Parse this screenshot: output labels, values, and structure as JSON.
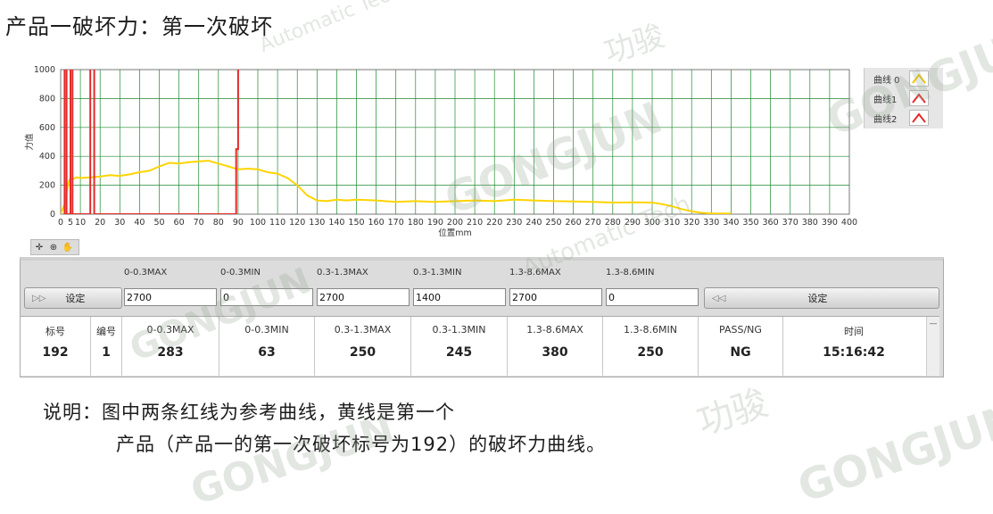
{
  "title": "产品一破坏力：第一次破坏",
  "chart_data": {
    "type": "line",
    "xlabel": "位置mm",
    "ylabel": "力值",
    "xlim": [
      0,
      400
    ],
    "ylim": [
      0,
      1000
    ],
    "x_ticks": [
      0,
      5,
      10,
      20,
      30,
      40,
      50,
      60,
      70,
      80,
      90,
      100,
      110,
      120,
      130,
      140,
      150,
      160,
      170,
      180,
      190,
      200,
      210,
      220,
      230,
      240,
      250,
      260,
      270,
      280,
      290,
      300,
      310,
      320,
      330,
      340,
      350,
      360,
      370,
      380,
      390,
      400
    ],
    "y_ticks": [
      0,
      200,
      400,
      600,
      800,
      1000
    ],
    "grid": true,
    "legend_position": "top-right",
    "series": [
      {
        "name": "曲线 0",
        "color": "#ffd400",
        "x": [
          0,
          2,
          4,
          5,
          6,
          8,
          10,
          15,
          20,
          25,
          30,
          35,
          40,
          45,
          50,
          55,
          60,
          65,
          70,
          75,
          80,
          85,
          90,
          95,
          100,
          105,
          110,
          115,
          120,
          125,
          130,
          135,
          140,
          145,
          150,
          160,
          170,
          180,
          190,
          200,
          210,
          220,
          230,
          240,
          250,
          260,
          270,
          280,
          290,
          300,
          305,
          310,
          315,
          320,
          325,
          330,
          335,
          340
        ],
        "y": [
          0,
          70,
          220,
          250,
          240,
          255,
          250,
          255,
          260,
          270,
          265,
          275,
          290,
          300,
          330,
          355,
          350,
          360,
          365,
          370,
          350,
          330,
          310,
          315,
          310,
          290,
          280,
          250,
          200,
          130,
          95,
          90,
          100,
          95,
          100,
          95,
          85,
          90,
          85,
          90,
          95,
          90,
          100,
          95,
          90,
          88,
          85,
          80,
          82,
          80,
          70,
          55,
          35,
          20,
          10,
          5,
          5,
          5
        ]
      },
      {
        "name": "曲线1",
        "color": "#e32b2b",
        "x": [
          2,
          2,
          3,
          3,
          15,
          15,
          17,
          17,
          89,
          89,
          90,
          90
        ],
        "y": [
          0,
          1050,
          1050,
          0,
          0,
          1050,
          1050,
          0,
          0,
          450,
          450,
          1050
        ]
      },
      {
        "name": "曲线2",
        "color": "#e32b2b",
        "x": [
          5,
          5,
          6,
          6
        ],
        "y": [
          0,
          1050,
          1050,
          0
        ]
      }
    ]
  },
  "legend": [
    {
      "label": "曲线 0",
      "color": "#f2c400"
    },
    {
      "label": "曲线1",
      "color": "#e32b2b"
    },
    {
      "label": "曲线2",
      "color": "#e32b2b"
    }
  ],
  "settings": {
    "left_button": "设定",
    "right_button": "设定",
    "headers": [
      "0-0.3MAX",
      "0-0.3MIN",
      "0.3-1.3MAX",
      "0.3-1.3MIN",
      "1.3-8.6MAX",
      "1.3-8.6MIN"
    ],
    "values": [
      "2700",
      "0",
      "2700",
      "1400",
      "2700",
      "0"
    ]
  },
  "results": {
    "headers": [
      "标号",
      "编号",
      "0-0.3MAX",
      "0-0.3MIN",
      "0.3-1.3MAX",
      "0.3-1.3MIN",
      "1.3-8.6MAX",
      "1.3-8.6MIN",
      "PASS/NG",
      "时间"
    ],
    "values": [
      "192",
      "1",
      "283",
      "63",
      "250",
      "245",
      "380",
      "250",
      "NG",
      "15:16:42"
    ]
  },
  "note": {
    "line1": "说明：图中两条红线为参考曲线，黄线是第一个",
    "line2": "产品（产品一的第一次破坏标号为192）的破坏力曲线。"
  },
  "watermark": {
    "brand": "GONGJUN",
    "cn": "功骏",
    "sub": "Automatic Tech",
    "tm": "™"
  }
}
